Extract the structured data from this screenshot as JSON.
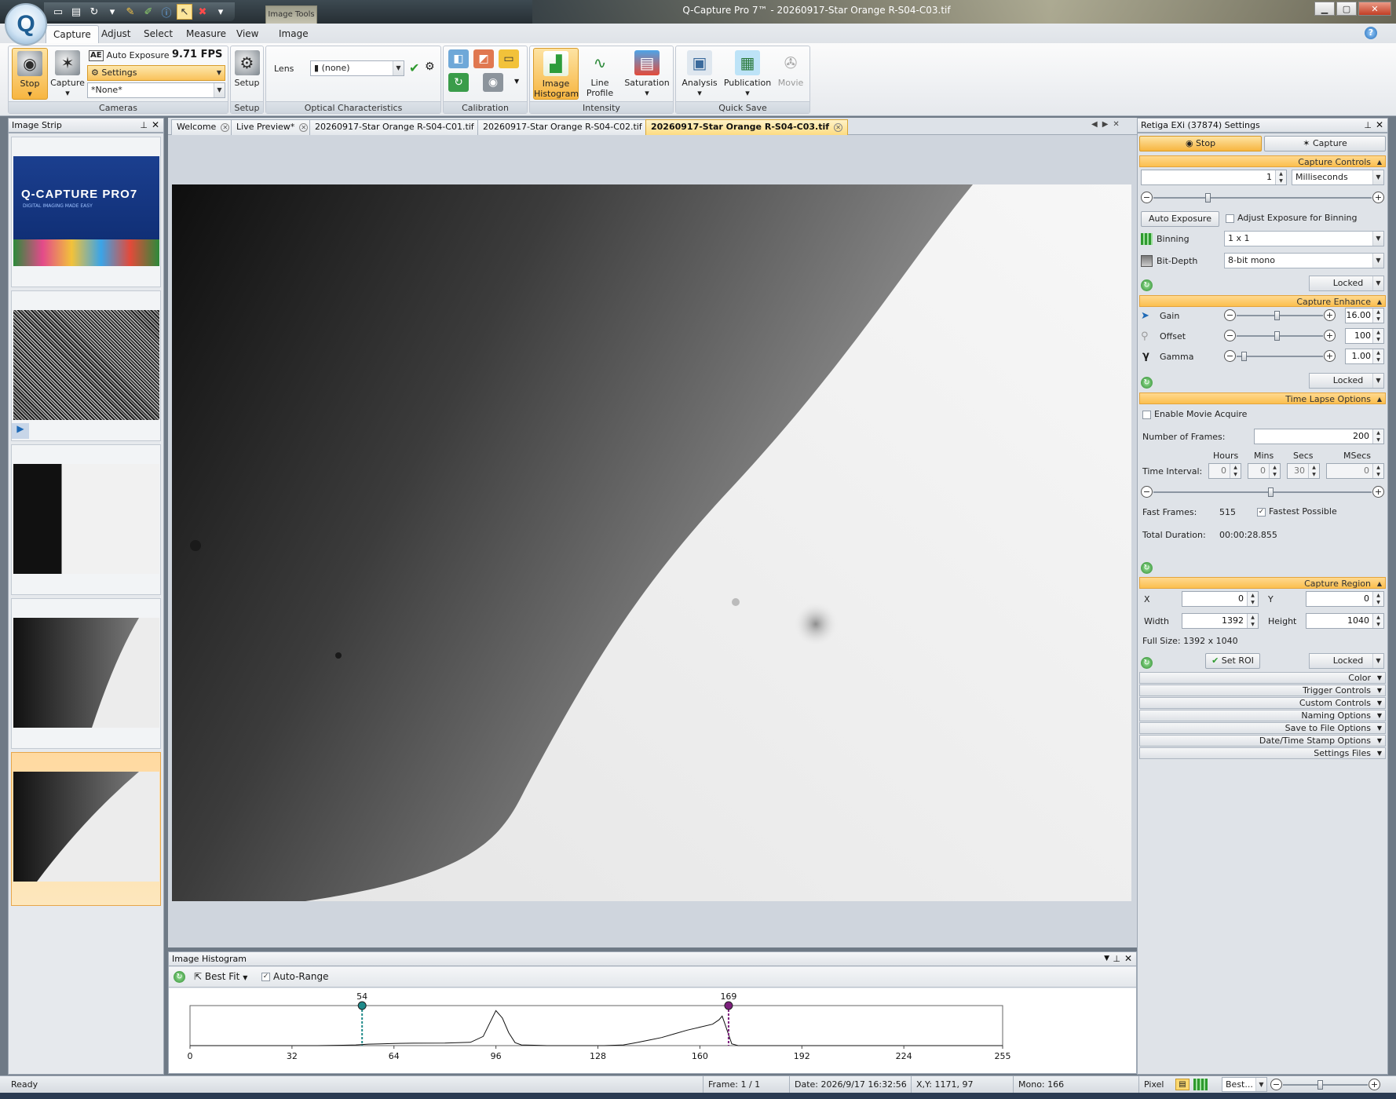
{
  "window": {
    "title": "Q-Capture Pro 7™ - 20260917-Star Orange R-S04-C03.tif",
    "context_tab": "Image Tools",
    "logo": "Q"
  },
  "qat": {
    "icons": [
      "window-icon",
      "save-icon",
      "redo-icon",
      "dropdown-icon",
      "pencil-icon",
      "brush-icon",
      "info-icon",
      "pointer-icon",
      "close-red-icon",
      "customize-icon"
    ]
  },
  "ribbon": {
    "tabs": [
      "Capture",
      "Adjust",
      "Select",
      "Measure",
      "View",
      "Image"
    ],
    "active_tab": "Capture",
    "cameras": {
      "stop": "Stop",
      "capture": "Capture",
      "auto_exposure": "Auto Exposure",
      "fps": "9.71 FPS",
      "settings": "Settings",
      "preset": "*None*",
      "label": "Cameras"
    },
    "setup": {
      "button": "Setup",
      "label": "Setup"
    },
    "optical": {
      "lens_label": "Lens",
      "lens_value": "(none)",
      "label": "Optical Characteristics"
    },
    "calibration": {
      "label": "Calibration"
    },
    "intensity": {
      "image_histogram": [
        "Image",
        "Histogram"
      ],
      "line_profile": [
        "Line",
        "Profile"
      ],
      "saturation": "Saturation",
      "label": "Intensity"
    },
    "quick_save": {
      "analysis": "Analysis",
      "publication": "Publication",
      "movie": "Movie",
      "label": "Quick Save"
    }
  },
  "image_strip": {
    "title": "Image Strip",
    "splash_title": "Q-CAPTURE PRO7",
    "splash_subtitle": "DIGITAL IMAGING MADE EASY"
  },
  "doc_tabs": [
    "Welcome",
    "Live Preview*",
    "20260917-Star Orange R-S04-C01.tif",
    "20260917-Star Orange R-S04-C02.tif",
    "20260917-Star Orange R-S04-C03.tif"
  ],
  "active_doc_tab": 4,
  "histogram": {
    "title": "Image Histogram",
    "fit": "Best Fit",
    "auto_range": "Auto-Range",
    "low_marker": "54",
    "high_marker": "169",
    "low_color": "#1f8a8a",
    "high_color": "#7d1f7d"
  },
  "chart_data": {
    "type": "line",
    "title": "",
    "xlabel": "",
    "ylabel": "",
    "x_ticks": [
      0,
      32,
      64,
      96,
      128,
      160,
      192,
      224,
      255
    ],
    "xlim": [
      0,
      255
    ],
    "ylim": [
      0,
      1
    ],
    "series": [
      {
        "x": [
          0,
          40,
          48,
          52,
          56,
          60,
          64,
          70,
          80,
          88,
          92,
          94,
          96,
          98,
          100,
          102,
          104,
          108,
          112,
          120,
          130,
          136,
          140,
          144,
          148,
          152,
          156,
          160,
          164,
          166,
          167,
          168,
          169,
          170,
          172,
          180,
          200,
          255
        ],
        "y": [
          0,
          0,
          0.01,
          0.02,
          0.04,
          0.05,
          0.06,
          0.065,
          0.07,
          0.09,
          0.25,
          0.6,
          0.95,
          0.75,
          0.35,
          0.08,
          0.02,
          0.01,
          0,
          0,
          0,
          0.02,
          0.08,
          0.15,
          0.22,
          0.32,
          0.42,
          0.5,
          0.58,
          0.7,
          0.8,
          0.55,
          0.3,
          0.05,
          0,
          0,
          0,
          0
        ]
      }
    ],
    "markers": [
      54,
      169
    ]
  },
  "settings_panel": {
    "title": "Retiga EXi (37874) Settings",
    "stop": "Stop",
    "capture": "Capture",
    "capture_controls": {
      "header": "Capture Controls",
      "exposure": "1",
      "unit": "Milliseconds",
      "auto_exposure": "Auto Exposure",
      "adjust_binning": "Adjust Exposure for Binning",
      "binning_label": "Binning",
      "binning": "1 x 1",
      "bitdepth_label": "Bit-Depth",
      "bitdepth": "8-bit mono",
      "locked": "Locked"
    },
    "capture_enhance": {
      "header": "Capture Enhance",
      "gain_label": "Gain",
      "gain": "16.00",
      "offset_label": "Offset",
      "offset": "100",
      "gamma_label": "Gamma",
      "gamma": "1.00",
      "locked": "Locked"
    },
    "time_lapse": {
      "header": "Time Lapse Options",
      "enable_movie": "Enable Movie Acquire",
      "frames_label": "Number of  Frames:",
      "frames": "200",
      "hours_label": "Hours",
      "mins_label": "Mins",
      "secs_label": "Secs",
      "msecs_label": "MSecs",
      "interval_label": "Time Interval:",
      "hours": "0",
      "mins": "0",
      "secs": "30",
      "msecs": "0",
      "fast_frames_label": "Fast Frames:",
      "fast_frames": "515",
      "fastest": "Fastest Possible",
      "total_label": "Total Duration:",
      "total": "00:00:28.855"
    },
    "capture_region": {
      "header": "Capture Region",
      "x_label": "X",
      "x": "0",
      "y_label": "Y",
      "y": "0",
      "width_label": "Width",
      "width": "1392",
      "height_label": "Height",
      "height": "1040",
      "full_size": "Full Size: 1392 x 1040",
      "set_roi": "Set ROI",
      "locked": "Locked"
    },
    "collapsed_sections": [
      "Color",
      "Trigger Controls",
      "Custom Controls",
      "Naming Options",
      "Save to File Options",
      "Date/Time Stamp Options",
      "Settings Files"
    ]
  },
  "status": {
    "ready": "Ready",
    "frame": "Frame: 1 / 1",
    "date": "Date: 2026/9/17 16:32:56",
    "xy": "X,Y: 1171,   97",
    "mono": "Mono:   166",
    "pixel": "Pixel",
    "zoom": "Best..."
  }
}
